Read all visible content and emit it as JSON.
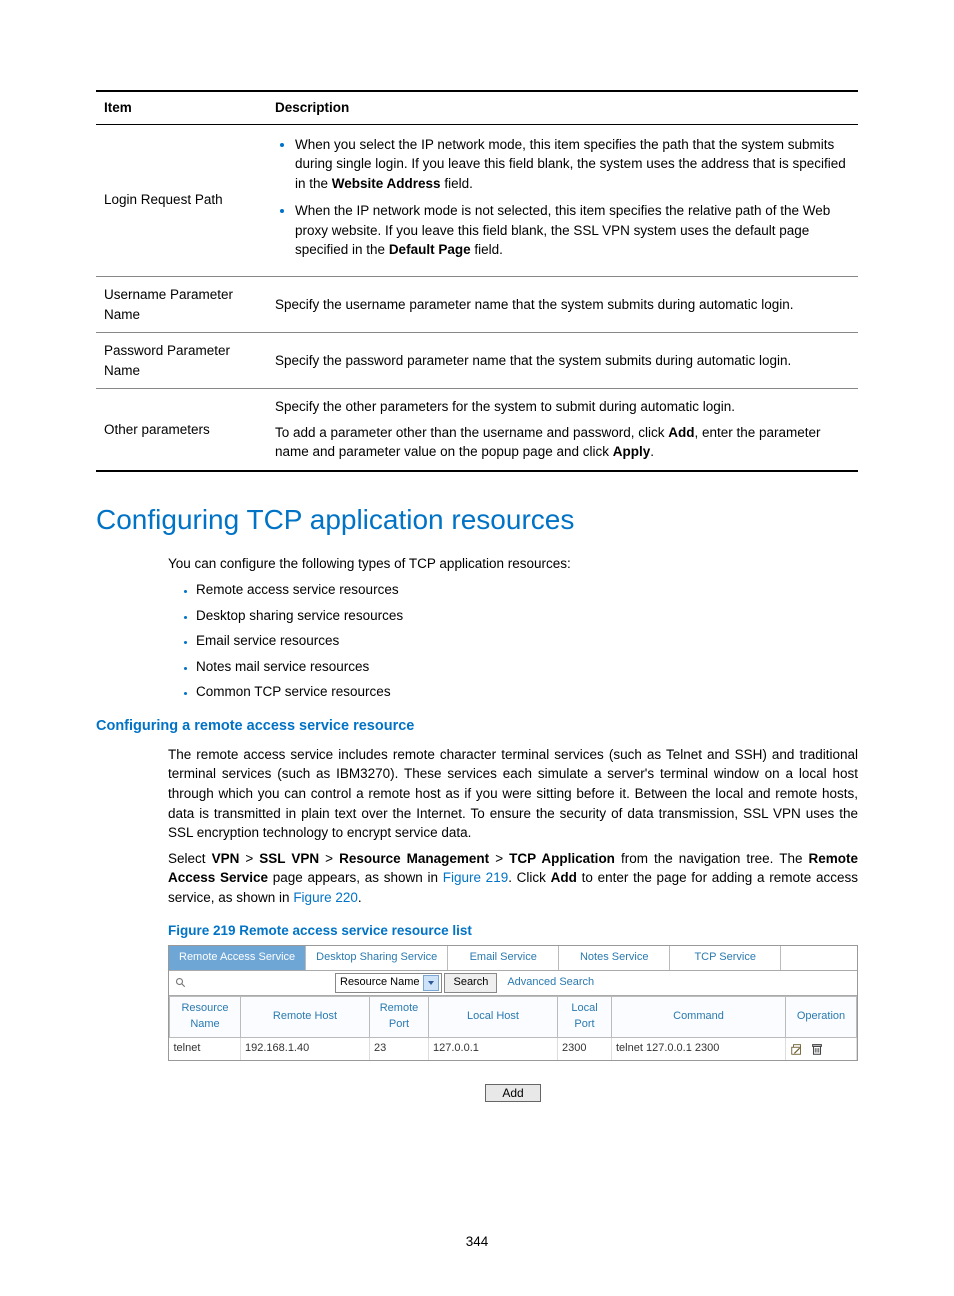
{
  "table": {
    "headers": [
      "Item",
      "Description"
    ],
    "rows": [
      {
        "item": "Login Request Path",
        "bullets": [
          {
            "pre": "When you select the IP network mode, this item specifies the path that the system submits during single login. If you leave this field blank, the system uses the address that is specified in the ",
            "bold": "Website Address",
            "post": " field."
          },
          {
            "pre": "When the IP network mode is not selected, this item specifies the relative path of the Web proxy website. If you leave this field blank, the SSL VPN system uses the default page specified in the ",
            "bold": "Default Page",
            "post": " field."
          }
        ]
      },
      {
        "item": "Username Parameter Name",
        "text": "Specify the username parameter name that the system submits during automatic login."
      },
      {
        "item": "Password Parameter Name",
        "text": "Specify the password parameter name that the system submits during automatic login."
      },
      {
        "item": "Other parameters",
        "para1": "Specify the other parameters for the system to submit during automatic login.",
        "para2_pre": "To add a parameter other than the username and password, click ",
        "para2_b1": "Add",
        "para2_mid": ", enter the parameter name and parameter value on the popup page and click ",
        "para2_b2": "Apply",
        "para2_post": "."
      }
    ]
  },
  "heading": "Configuring TCP application resources",
  "intro": "You can configure the following types of TCP application resources:",
  "types": [
    "Remote access service resources",
    "Desktop sharing service resources",
    "Email service resources",
    "Notes mail service resources",
    "Common TCP service resources"
  ],
  "sub_heading": "Configuring a remote access service resource",
  "para1": "The remote access service includes remote character terminal services (such as Telnet and SSH) and traditional terminal services (such as IBM3270). These services each simulate a server's terminal window on a local host through which you can control a remote host as if you were sitting before it. Between the local and remote hosts, data is transmitted in plain text over the Internet. To ensure the security of data transmission, SSL VPN uses the SSL encryption technology to encrypt service data.",
  "para2": {
    "p1": "Select ",
    "b1": "VPN",
    "s1": " > ",
    "b2": "SSL VPN",
    "s2": " > ",
    "b3": "Resource Management",
    "s3": " > ",
    "b4": "TCP Application",
    "p2": " from the navigation tree. The ",
    "b5": "Remote Access Service",
    "p3": " page appears, as shown in ",
    "link1": "Figure 219",
    "p4": ". Click ",
    "b6": "Add",
    "p5": " to enter the page for adding a remote access service, as shown in ",
    "link2": "Figure 220",
    "p6": "."
  },
  "fig_caption": "Figure 219 Remote access service resource list",
  "ui": {
    "tabs": [
      "Remote Access Service",
      "Desktop Sharing Service",
      "Email Service",
      "Notes Service",
      "TCP Service"
    ],
    "combo": "Resource Name",
    "search_btn": "Search",
    "adv": "Advanced Search",
    "cols": [
      "Resource Name",
      "Remote Host",
      "Remote Port",
      "Local Host",
      "Local Port",
      "Command",
      "Operation"
    ],
    "row": {
      "rn": "telnet",
      "rh": "192.168.1.40",
      "rp": "23",
      "lh": "127.0.0.1",
      "lp": "2300",
      "cmd": "telnet 127.0.0.1 2300"
    },
    "add": "Add"
  },
  "page": "344"
}
